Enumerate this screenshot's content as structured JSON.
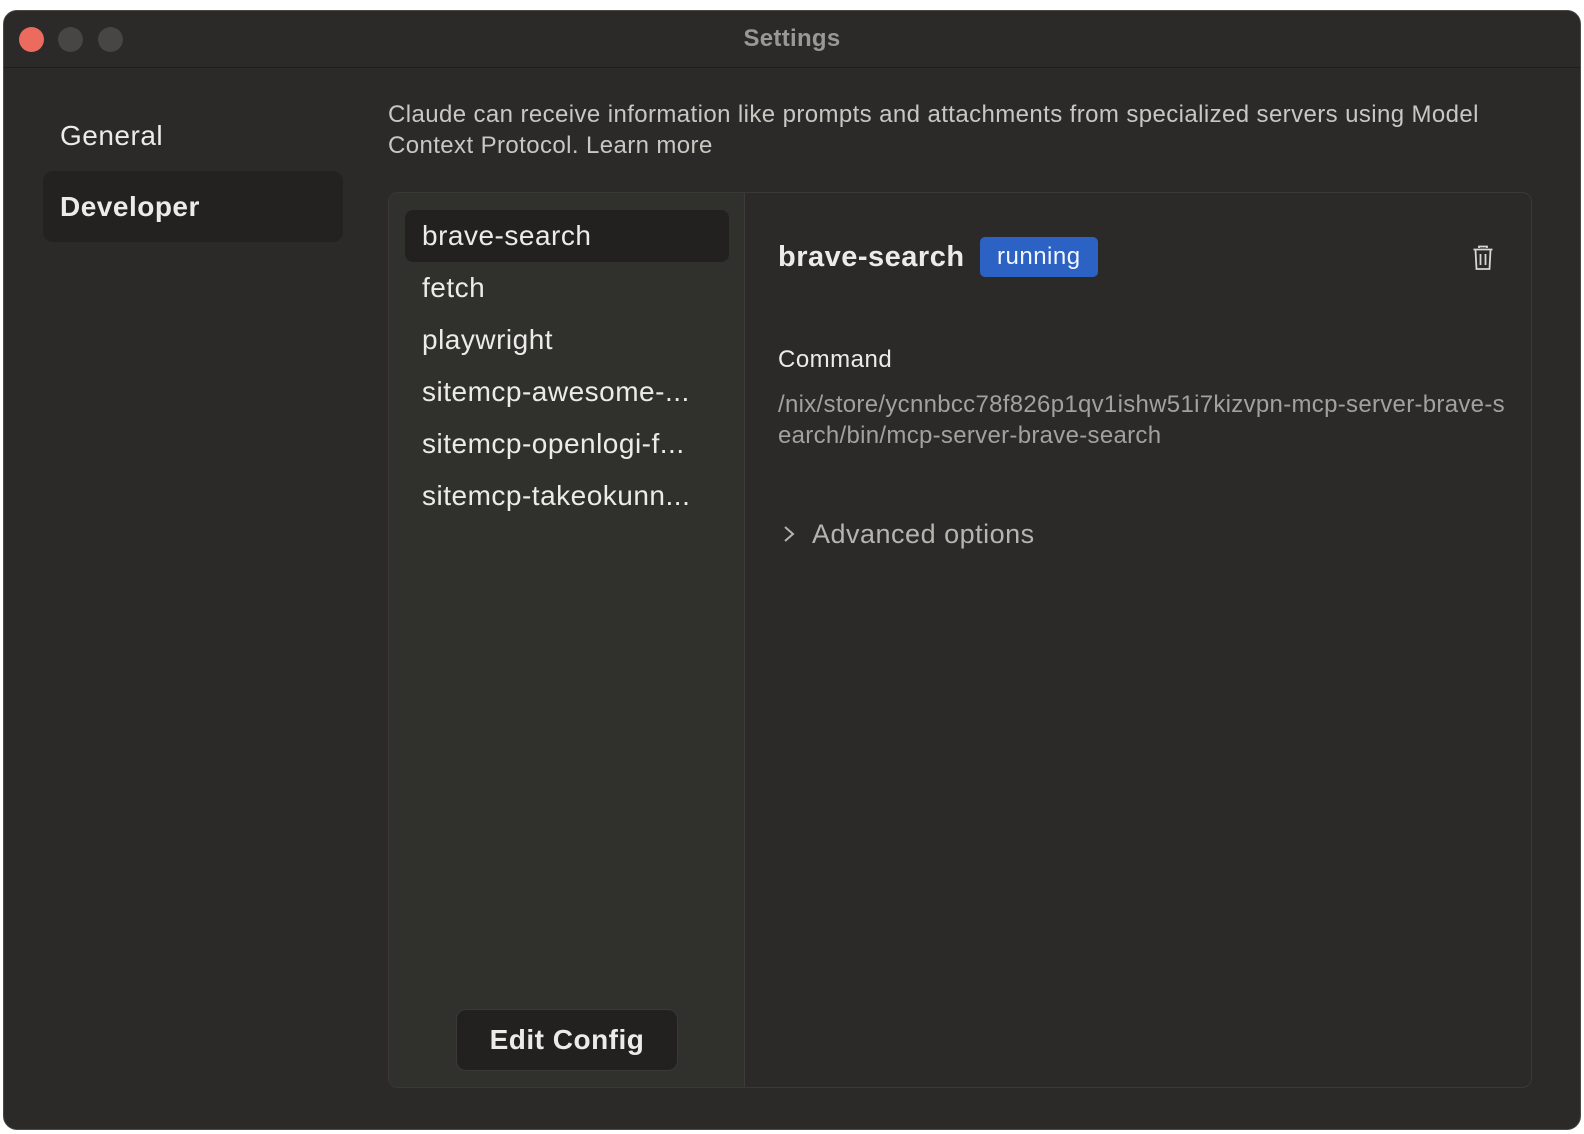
{
  "window": {
    "title": "Settings"
  },
  "sidebar": {
    "items": [
      {
        "label": "General",
        "selected": false
      },
      {
        "label": "Developer",
        "selected": true
      }
    ]
  },
  "intro": {
    "text": "Claude can receive information like prompts and attachments from specialized servers using Model Context Protocol.",
    "link": "Learn more"
  },
  "servers": {
    "items": [
      {
        "label": "brave-search",
        "selected": true
      },
      {
        "label": "fetch",
        "selected": false
      },
      {
        "label": "playwright",
        "selected": false
      },
      {
        "label": "sitemcp-awesome-...",
        "selected": false
      },
      {
        "label": "sitemcp-openlogi-f...",
        "selected": false
      },
      {
        "label": "sitemcp-takeokunn...",
        "selected": false
      }
    ],
    "edit_config_label": "Edit Config"
  },
  "detail": {
    "name": "brave-search",
    "status": "running",
    "command_label": "Command",
    "command_value": "/nix/store/ycnnbcc78f826p1qv1ishw51i7kizvpn-mcp-server-brave-search/bin/mcp-server-brave-search",
    "advanced_label": "Advanced options"
  },
  "colors": {
    "background": "#2b2a28",
    "status_badge": "#2b62c3",
    "close_button": "#ed6a5e"
  },
  "icons": {
    "delete": "trash-icon",
    "advanced_toggle": "chevron-right-icon"
  }
}
